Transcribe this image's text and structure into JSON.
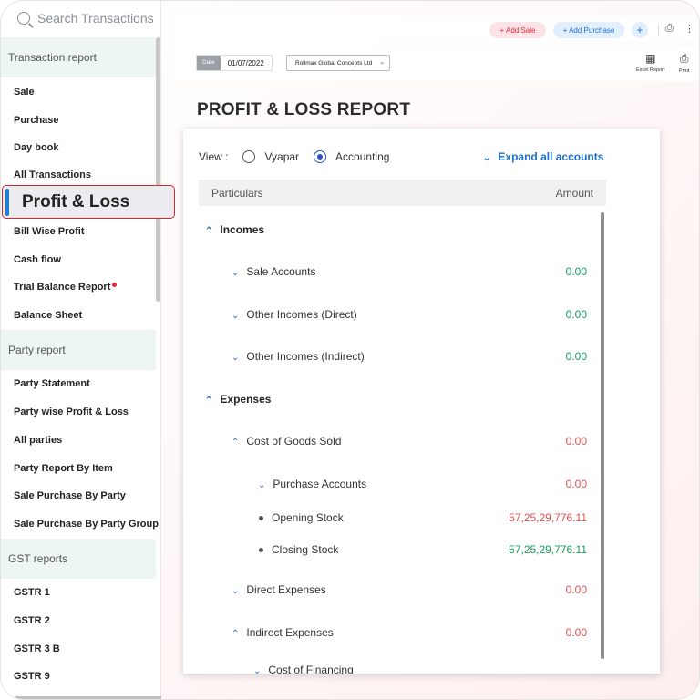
{
  "search": {
    "placeholder": "Search Transactions"
  },
  "sidebar": {
    "sections": [
      {
        "title": "Transaction report",
        "items": [
          "Sale",
          "Purchase",
          "Day book",
          "All Transactions",
          "Profit & Loss",
          "Bill Wise Profit",
          "Cash flow",
          "Trial Balance Report",
          "Balance Sheet"
        ]
      },
      {
        "title": "Party report",
        "items": [
          "Party Statement",
          "Party wise Profit & Loss",
          "All parties",
          "Party Report By Item",
          "Sale Purchase By Party",
          "Sale Purchase By Party Group"
        ]
      },
      {
        "title": "GST reports",
        "items": [
          "GSTR 1",
          "GSTR 2",
          "GSTR 3 B",
          "GSTR 9"
        ]
      }
    ],
    "active_item": "Profit & Loss",
    "badge_color": "#e8283b"
  },
  "topbar": {
    "add_sale": "+ Add Sale",
    "add_purchase": "+ Add Purchase",
    "add_more": "+"
  },
  "filters": {
    "date_label": "Date",
    "date_value": "01/07/2022",
    "firm": "Rollmax Global Concepts Ltd",
    "excel_label": "Excel Report",
    "print_label": "Print"
  },
  "page": {
    "title": "PROFIT & LOSS REPORT"
  },
  "report": {
    "view_label": "View :",
    "view_options": [
      "Vyapar",
      "Accounting"
    ],
    "selected_view": "Accounting",
    "expand_all": "Expand all accounts",
    "columns": [
      "Particulars",
      "Amount"
    ],
    "rows": [
      {
        "label": "Incomes",
        "amount": ""
      },
      {
        "label": "Sale Accounts",
        "amount": "0.00"
      },
      {
        "label": "Other Incomes (Direct)",
        "amount": "0.00"
      },
      {
        "label": "Other Incomes (Indirect)",
        "amount": "0.00"
      },
      {
        "label": "Expenses",
        "amount": ""
      },
      {
        "label": "Cost of Goods Sold",
        "amount": "0.00"
      },
      {
        "label": "Purchase Accounts",
        "amount": "0.00"
      },
      {
        "label": "Opening Stock",
        "amount": "57,25,29,776.11"
      },
      {
        "label": "Closing Stock",
        "amount": "57,25,29,776.11"
      },
      {
        "label": "Direct Expenses",
        "amount": "0.00"
      },
      {
        "label": "Indirect Expenses",
        "amount": "0.00"
      },
      {
        "label": "Cost of Financing",
        "amount": ""
      }
    ],
    "colors": {
      "positive": "#17a05d",
      "negative": "#e05252",
      "accent": "#1c6fd0"
    }
  }
}
